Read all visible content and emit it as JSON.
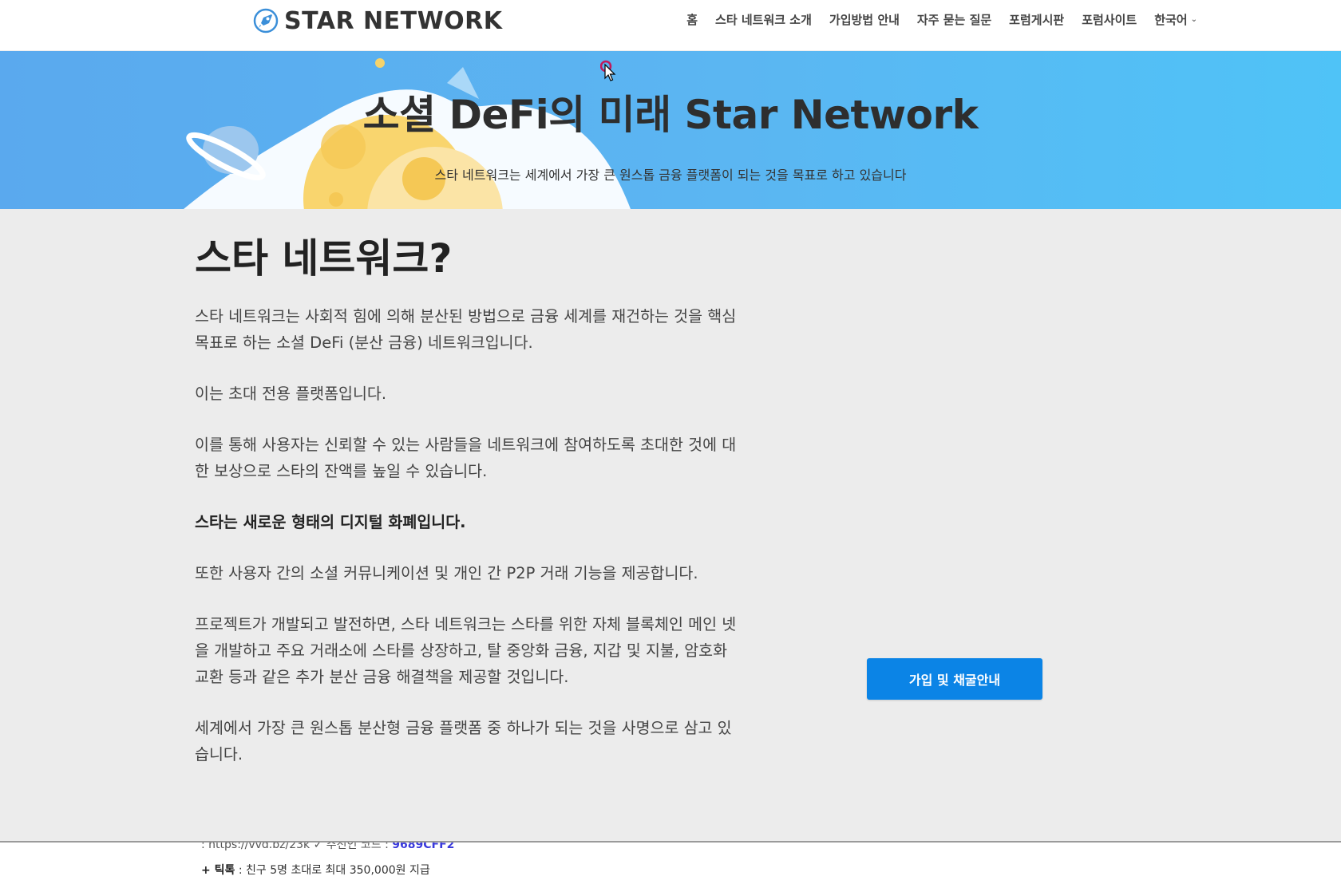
{
  "header": {
    "logo_text": "STAR NETWORK",
    "nav": [
      "홈",
      "스타 네트워크 소개",
      "가입방법 안내",
      "자주 묻는 질문",
      "포럼게시판",
      "포럼사이트"
    ],
    "language": "한국어"
  },
  "hero": {
    "title": "소셜 DeFi의 미래 Star Network",
    "subtitle": "스타 네트워크는 세계에서 가장 큰 원스톱 금융 플랫폼이 되는 것을 목표로 하고 있습니다"
  },
  "content": {
    "heading": "스타 네트워크?",
    "paragraphs": [
      "스타 네트워크는 사회적 힘에 의해 분산된 방법으로 금융 세계를 재건하는 것을 핵심 목표로 하는 소셜 DeFi (분산 금융) 네트워크입니다.",
      "이는 초대 전용 플랫폼입니다.",
      "이를 통해 사용자는 신뢰할 수 있는 사람들을 네트워크에 참여하도록 초대한 것에 대한 보상으로 스타의 잔액를 높일 수 있습니다.",
      "스타는 새로운 형태의 디지털 화폐입니다.",
      "또한 사용자 간의 소셜 커뮤니케이션 및 개인 간 P2P 거래 기능을 제공합니다.",
      "프로젝트가 개발되고 발전하면, 스타 네트워크는 스타를 위한 자체 블록체인 메인 넷을 개발하고 주요 거래소에 스타를 상장하고, 탈 중앙화 금융, 지갑 및 지불, 암호화 교환 등과 같은 추가 분산 금융 해결책을 제공할 것입니다.",
      "세계에서 가장 큰 원스톱 분산형 금융 플랫폼 중 하나가 되는 것을 사명으로 삼고 있습니다."
    ],
    "cta_label": "가입 및 채굴안내"
  },
  "below": {
    "link_text": ": https://vvd.bz/23k",
    "code_label": "추천인 코드 :",
    "code_value": "9689CFF2",
    "tiktok_label": "+ 틱톡",
    "tiktok_text": ": 친구 5명 초대로 최대 350,000원 지급"
  },
  "colors": {
    "primary": "#0b84e6",
    "hero_bg": "#5bb6f2",
    "content_bg": "#ececec"
  }
}
